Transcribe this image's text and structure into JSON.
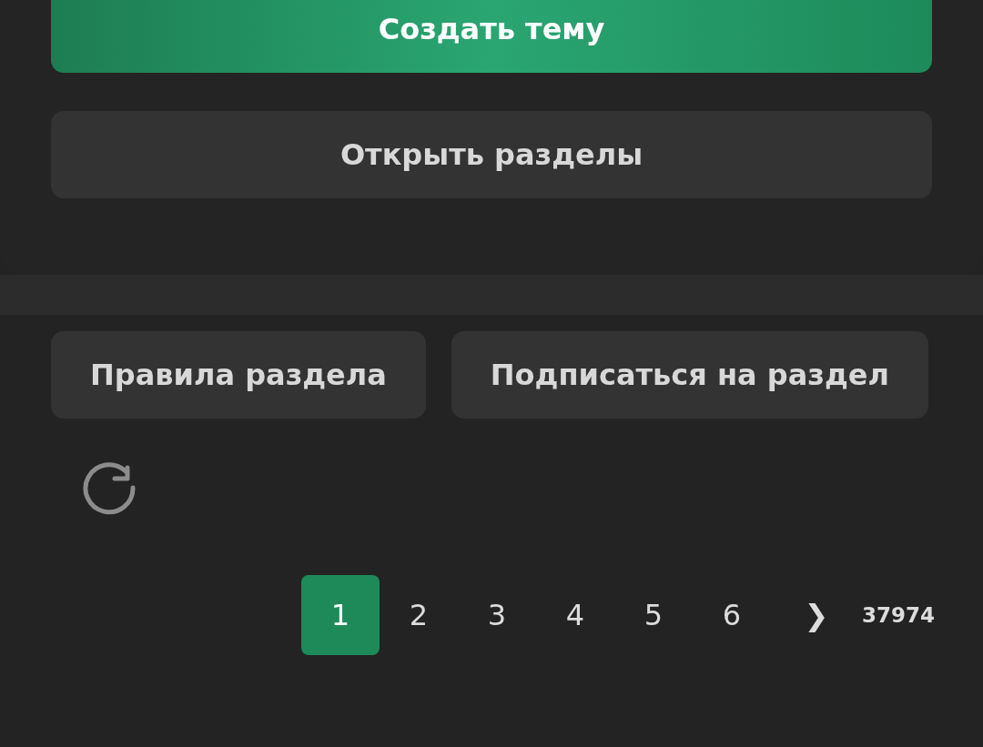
{
  "actions": [
    {
      "label": "Создать тему",
      "kind": "primary"
    },
    {
      "label": "Открыть разделы",
      "kind": "secondary"
    }
  ],
  "forum_buttons": [
    "Правила раздела",
    "Подписаться на раздел"
  ],
  "pagination": {
    "pages": [
      {
        "label": "1",
        "selected": true
      },
      {
        "label": "2",
        "selected": false
      },
      {
        "label": "3",
        "selected": false
      },
      {
        "label": "4",
        "selected": false
      },
      {
        "label": "5",
        "selected": false
      },
      {
        "label": "6",
        "selected": false
      }
    ],
    "next": "❯",
    "last": "37974"
  }
}
